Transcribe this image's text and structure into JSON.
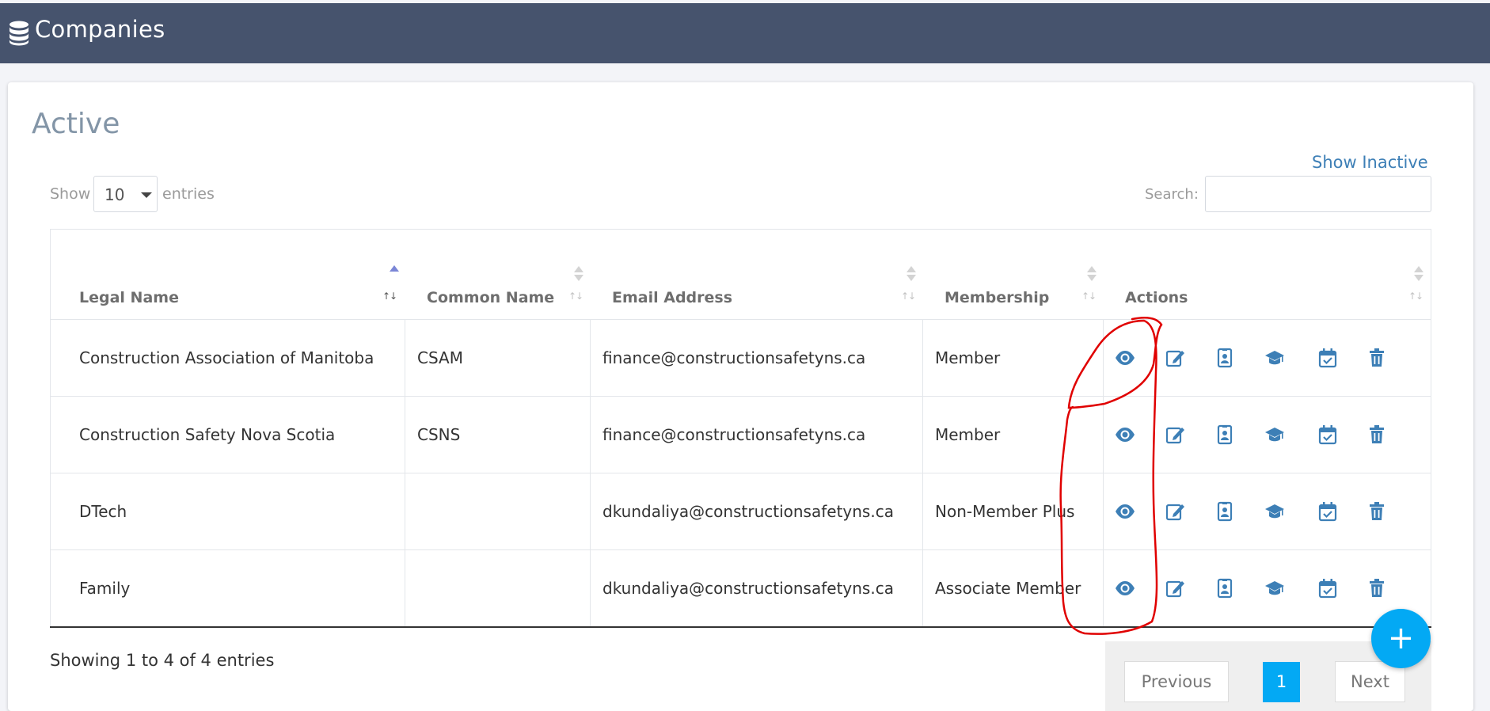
{
  "header": {
    "title": "Companies",
    "icon": "database-icon"
  },
  "section": {
    "title": "Active"
  },
  "show_inactive_label": "Show Inactive",
  "length_menu": {
    "show_label": "Show",
    "value": "10",
    "entries_label": "entries"
  },
  "search": {
    "label": "Search:",
    "value": ""
  },
  "table": {
    "columns": [
      "Legal Name",
      "Common Name",
      "Email Address",
      "Membership",
      "Actions"
    ],
    "sorted_column": "Legal Name",
    "sort_direction": "ascending",
    "rows": [
      {
        "legal_name": "Construction Association of Manitoba",
        "common_name": "CSAM",
        "email": "finance@constructionsafetyns.ca",
        "membership": "Member"
      },
      {
        "legal_name": "Construction Safety Nova Scotia",
        "common_name": "CSNS",
        "email": "finance@constructionsafetyns.ca",
        "membership": "Member"
      },
      {
        "legal_name": "DTech",
        "common_name": "",
        "email": "dkundaliya@constructionsafetyns.ca",
        "membership": "Non-Member Plus"
      },
      {
        "legal_name": "Family",
        "common_name": "",
        "email": "dkundaliya@constructionsafetyns.ca",
        "membership": "Associate Member"
      }
    ],
    "action_icons": [
      "eye-icon",
      "edit-icon",
      "id-badge-icon",
      "graduation-cap-icon",
      "calendar-check-icon",
      "trash-icon"
    ]
  },
  "info": "Showing 1 to 4 of 4 entries",
  "pagination": {
    "previous": "Previous",
    "current_page": "1",
    "next": "Next"
  },
  "fab": {
    "label": "+"
  },
  "colors": {
    "topbar": "#46536d",
    "accent": "#03a9f4",
    "icon": "#3d7fb6",
    "heading": "#8395a7",
    "annotation": "#e00000"
  }
}
